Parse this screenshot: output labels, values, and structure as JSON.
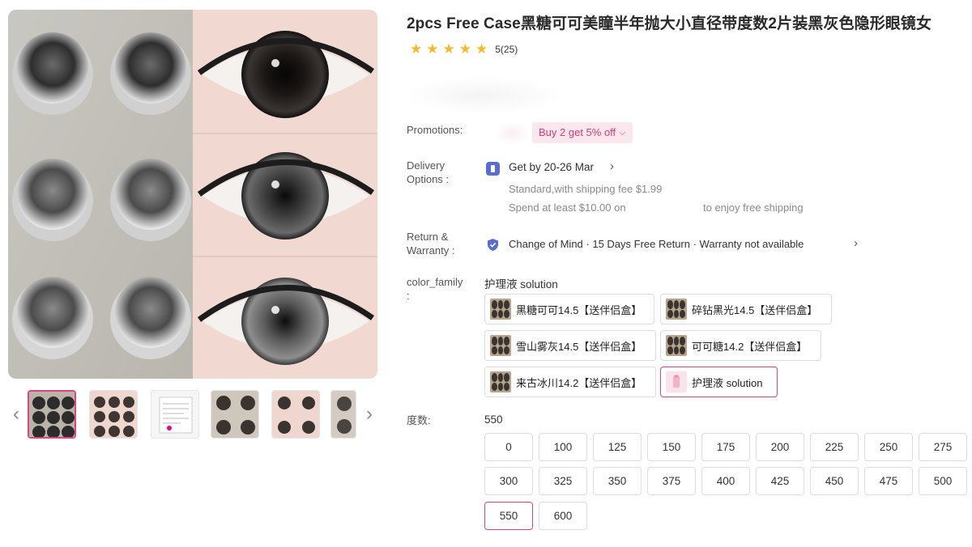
{
  "product": {
    "title": "2pcs Free Case黑糖可可美瞳半年抛大小直径带度数2片装黑灰色隐形眼镜女",
    "rating_text": "5(25)",
    "star_count": 5
  },
  "promotions": {
    "label": "Promotions:",
    "tag": "Buy 2 get 5% off"
  },
  "delivery": {
    "label_line1": "Delivery",
    "label_line2": "Options :",
    "eta": "Get by 20-26 Mar",
    "shipping": "Standard,with shipping fee $1.99",
    "free_shipping_prefix": "Spend at least $10.00 on",
    "free_shipping_suffix": "to enjoy free shipping"
  },
  "returns": {
    "label_line1": "Return &",
    "label_line2": "Warranty :",
    "text": "Change of Mind · 15 Days Free Return · Warranty not available"
  },
  "color_family": {
    "label_line1": "color_family",
    "label_line2": ":",
    "selected": "护理液 solution",
    "options": [
      "黑糖可可14.5【送伴侣盒】",
      "碎钻黑光14.5【送伴侣盒】",
      "雪山雾灰14.5【送伴侣盒】",
      "可可糖14.2【送伴侣盒】",
      "来古冰川14.2【送伴侣盒】",
      "护理液 solution"
    ]
  },
  "power": {
    "label": "度数:",
    "selected": "550",
    "options": [
      "0",
      "100",
      "125",
      "150",
      "175",
      "200",
      "225",
      "250",
      "275",
      "300",
      "325",
      "350",
      "375",
      "400",
      "425",
      "450",
      "475",
      "500",
      "550",
      "600"
    ]
  },
  "colors": {
    "accent": "#e0447c",
    "star": "#f7b928",
    "promo_bg": "#fde7ef"
  }
}
